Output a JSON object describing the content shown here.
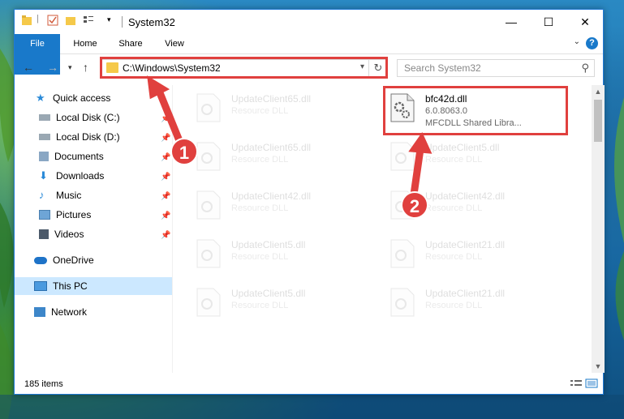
{
  "window": {
    "title": "System32"
  },
  "ribbon": {
    "tabs": [
      {
        "label": "File"
      },
      {
        "label": "Home"
      },
      {
        "label": "Share"
      },
      {
        "label": "View"
      }
    ],
    "help": "?"
  },
  "navigation": {
    "address": "C:\\Windows\\System32",
    "search_placeholder": "Search System32"
  },
  "sidebar": {
    "items": [
      {
        "label": "Quick access",
        "icon": "star-icon"
      },
      {
        "label": "Local Disk (C:)",
        "icon": "drive-icon",
        "pinned": true
      },
      {
        "label": "Local Disk (D:)",
        "icon": "drive-icon",
        "pinned": true
      },
      {
        "label": "Documents",
        "icon": "documents-icon",
        "pinned": true
      },
      {
        "label": "Downloads",
        "icon": "download-icon",
        "pinned": true
      },
      {
        "label": "Music",
        "icon": "music-icon",
        "pinned": true
      },
      {
        "label": "Pictures",
        "icon": "pictures-icon",
        "pinned": true
      },
      {
        "label": "Videos",
        "icon": "videos-icon",
        "pinned": true
      },
      {
        "label": "OneDrive",
        "icon": "cloud-icon"
      },
      {
        "label": "This PC",
        "icon": "computer-icon",
        "selected": true
      },
      {
        "label": "Network",
        "icon": "network-icon"
      }
    ]
  },
  "files": [
    {
      "name": "UpdateClient65.dll",
      "type": "Resource DLL"
    },
    {
      "name": "bfc42d.dll",
      "version": "6.0.8063.0",
      "description": "MFCDLL Shared Libra..."
    },
    {
      "name": "UpdateClient65.dll",
      "type": "Resource DLL"
    },
    {
      "name": "UpdateClient5.dll",
      "type": "Resource DLL"
    },
    {
      "name": "UpdateClient42.dll",
      "type": "Resource DLL"
    },
    {
      "name": "UpdateClient42.dll",
      "type": "Resource DLL"
    },
    {
      "name": "UpdateClient5.dll",
      "type": "Resource DLL"
    },
    {
      "name": "UpdateClient21.dll",
      "type": "Resource DLL"
    },
    {
      "name": "UpdateClient5.dll",
      "type": "Resource DLL"
    },
    {
      "name": "UpdateClient21.dll",
      "type": "Resource DLL"
    }
  ],
  "status": {
    "item_count": "185 items"
  },
  "annotations": {
    "step1": "1",
    "step2": "2",
    "color": "#e0403e"
  }
}
